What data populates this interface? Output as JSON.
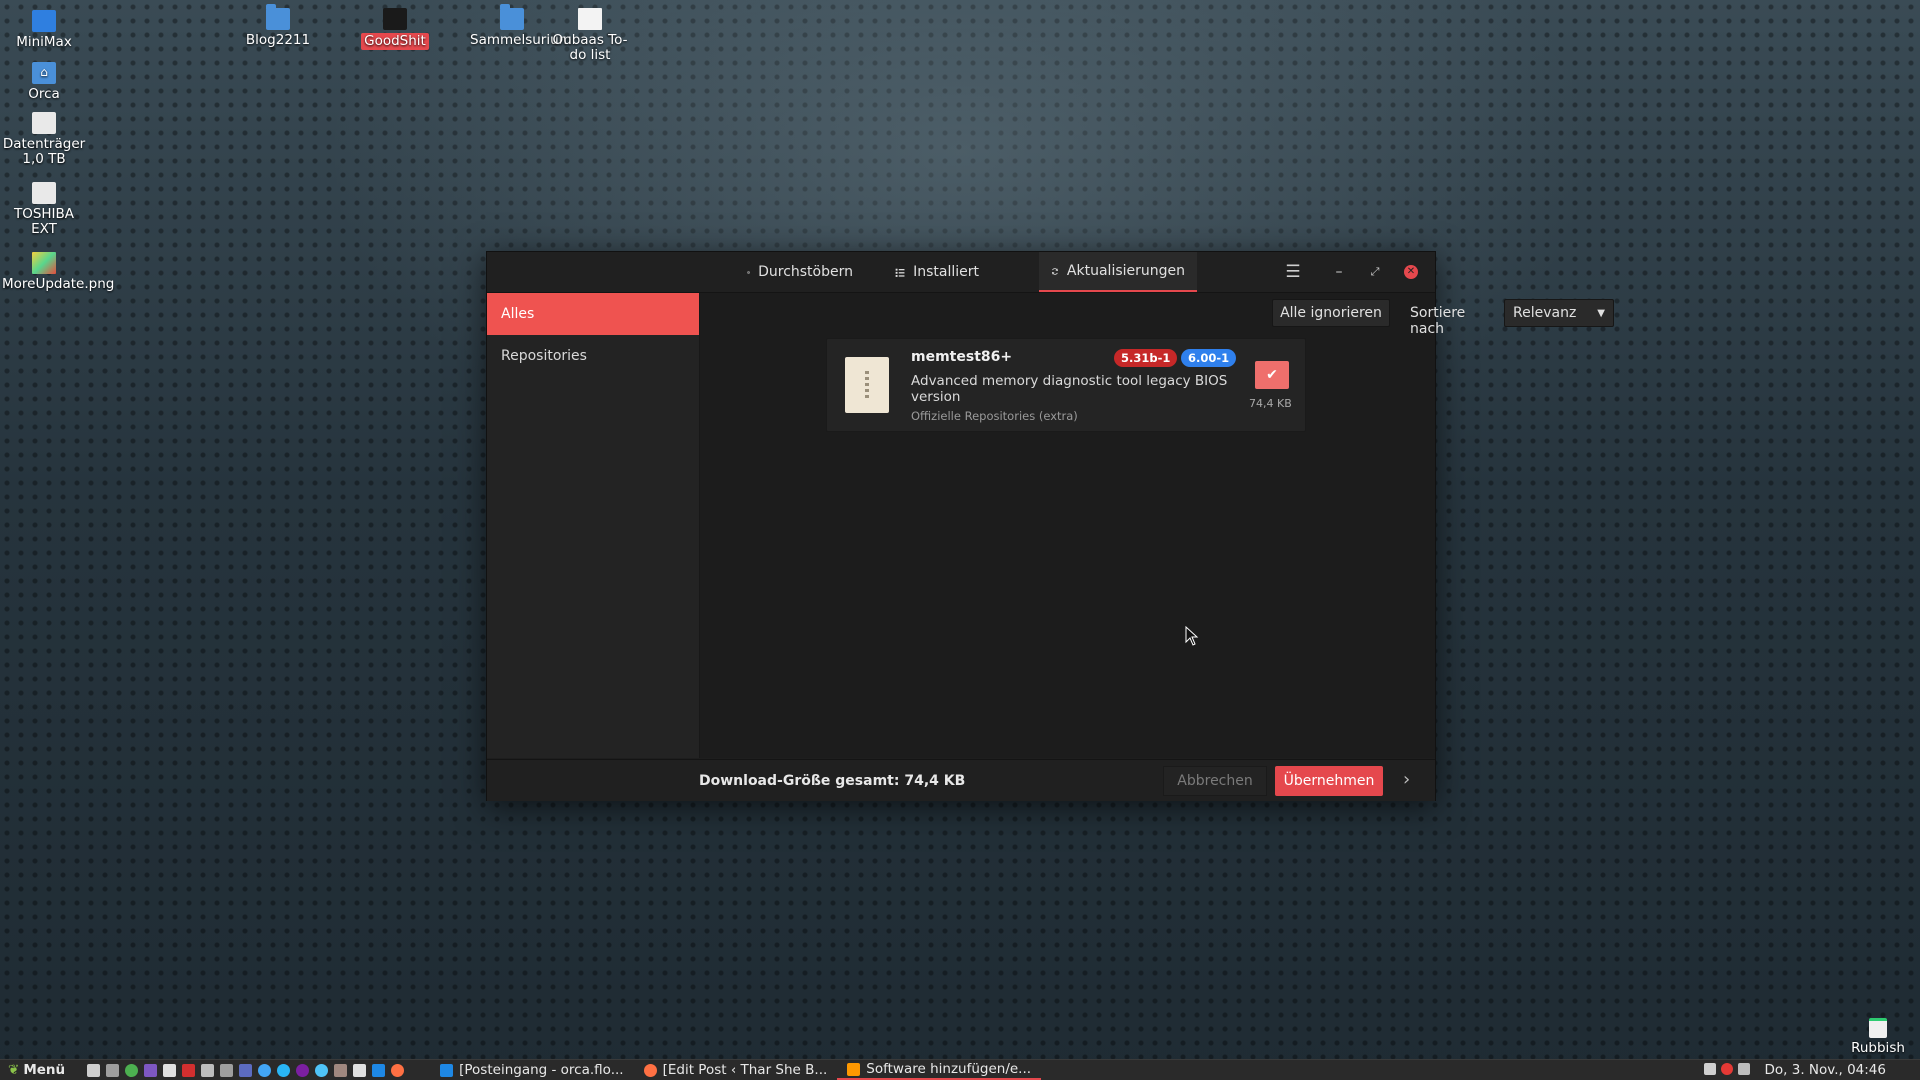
{
  "desktop": {
    "icons_left": [
      {
        "label": "MiniMax",
        "icon": "monitor-icon"
      },
      {
        "label": "Orca",
        "icon": "home-folder-icon"
      },
      {
        "label": "Datenträger 1,0 TB",
        "icon": "drive-icon"
      },
      {
        "label": "TOSHIBA EXT",
        "icon": "drive-icon"
      },
      {
        "label": "MoreUpdate.png",
        "icon": "image-file-icon"
      }
    ],
    "icons_top": [
      {
        "label": "Blog2211",
        "icon": "folder-icon"
      },
      {
        "label": "GoodShit",
        "icon": "dark-file-icon",
        "selected": true
      },
      {
        "label": "Sammelsurium",
        "icon": "folder-icon"
      },
      {
        "label": "Oubaas To-do list",
        "icon": "document-icon"
      }
    ],
    "trash": {
      "label": "Rubbish",
      "icon": "trash-icon"
    }
  },
  "window": {
    "tabs": [
      {
        "label": "Durchstöbern",
        "icon": "globe-icon"
      },
      {
        "label": "Installiert",
        "icon": "list-icon"
      },
      {
        "label": "Aktualisierungen",
        "icon": "refresh-icon",
        "active": true
      }
    ],
    "sidebar": {
      "items": [
        {
          "label": "Alles",
          "active": true
        },
        {
          "label": "Repositories"
        }
      ]
    },
    "toolbar": {
      "ignore_all": "Alle ignorieren",
      "sort_label": "Sortiere nach",
      "sort_value": "Relevanz"
    },
    "packages": [
      {
        "name": "memtest86+",
        "description": "Advanced memory diagnostic tool legacy BIOS version",
        "repository": "Offizielle Repositories (extra)",
        "old_version": "5.31b-1",
        "new_version": "6.00-1",
        "size": "74,4 KB",
        "checked": true
      }
    ],
    "footer": {
      "total": "Download-Größe gesamt: 74,4 KB",
      "cancel": "Abbrechen",
      "apply": "Übernehmen"
    }
  },
  "taskbar": {
    "menu_label": "Menü",
    "tasks": [
      {
        "label": "[Posteingang - orca.flo..."
      },
      {
        "label": "[Edit Post ‹ Thar She B..."
      },
      {
        "label": "Software hinzufügen/e...",
        "active": true
      }
    ],
    "clock": "Do,  3. Nov., 04:46"
  },
  "colors": {
    "accent": "#e5484d",
    "old_version_badge": "#c0392b",
    "new_version_badge": "#2f80ed"
  }
}
